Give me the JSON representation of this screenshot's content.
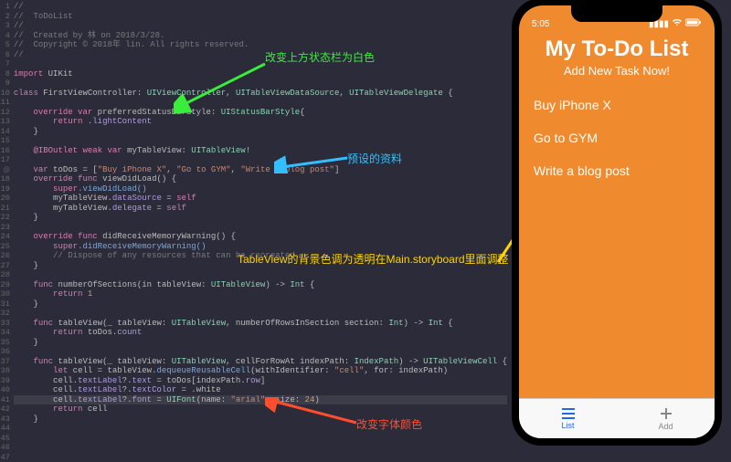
{
  "file": {
    "name": "ToDoList",
    "author": "林 on 2018/3/28."
  },
  "gutter": [
    "1",
    "2",
    "3",
    "4",
    "5",
    "6",
    "7",
    "8",
    "9",
    "10",
    "11",
    "12",
    "13",
    "14",
    "15",
    "16",
    "17",
    "◎",
    "18",
    "19",
    "20",
    "21",
    "22",
    "23",
    "24",
    "25",
    "26",
    "27",
    "28",
    "29",
    "30",
    "31",
    "32",
    "33",
    "34",
    "35",
    "36",
    "37",
    "38",
    "39",
    "40",
    "41",
    "42",
    "43",
    "44",
    "45",
    "46",
    "47"
  ],
  "code": {
    "l1": "//",
    "l2": "//  ToDoList",
    "l3": "//",
    "l4_a": "//  Created by ",
    "l4_b": "林 on 2018/3/28.",
    "l5": "//  Copyright © 2018年 lin. All rights reserved.",
    "l6": "//",
    "l7_kw": "import",
    "l7_b": " UIKit",
    "l9_kw": "class",
    "l9_name": " FirstViewController",
    "l9_b": ": ",
    "l9_t1": "UIViewController",
    "l9_c": ", ",
    "l9_t2": "UITableViewDataSource",
    "l9_d": ", ",
    "l9_t3": "UITableViewDelegate",
    "l9_e": " {",
    "l11_a": "    override var",
    "l11_b": " preferredStatusBarStyle",
    "l11_c": ": ",
    "l11_d": "UIStatusBarStyle",
    "l11_e": "{",
    "l12_a": "        return",
    "l12_b": " .lightContent",
    "l13": "    }",
    "l15_a": "    @IBOutlet weak var",
    "l15_b": " myTableView: ",
    "l15_c": "UITableView",
    "l15_d": "!",
    "l17_a": "    var",
    "l17_b": " toDos = [",
    "l17_s1": "\"Buy iPhone X\"",
    "l17_c": ", ",
    "l17_s2": "\"Go to GYM\"",
    "l17_d": ", ",
    "l17_s3": "\"Write a blog post\"",
    "l17_e": "]",
    "l18_a": "    override func",
    "l18_b": " viewDidLoad() {",
    "l19_a": "        super",
    "l19_b": ".viewDidLoad()",
    "l20_a": "        myTableView.",
    "l20_b": "dataSource",
    "l20_c": " = ",
    "l20_d": "self",
    "l21_a": "        myTableView.",
    "l21_b": "delegate",
    "l21_c": " = ",
    "l21_d": "self",
    "l22": "    }",
    "l24_a": "    override func",
    "l24_b": " didReceiveMemoryWarning() {",
    "l25_a": "        super",
    "l25_b": ".didReceiveMemoryWarning()",
    "l26": "        // Dispose of any resources that can be recreated.",
    "l27": "    }",
    "l29_a": "    func",
    "l29_b": " numberOfSections(in tableView: ",
    "l29_c": "UITableView",
    "l29_d": ") -> ",
    "l29_e": "Int",
    "l29_f": " {",
    "l30_a": "        return",
    "l30_b": " 1",
    "l31": "    }",
    "l33_a": "    func",
    "l33_b": " tableView(_ tableView: ",
    "l33_c": "UITableView",
    "l33_d": ", numberOfRowsInSection section: ",
    "l33_e": "Int",
    "l33_f": ") -> ",
    "l33_g": "Int",
    "l33_h": " {",
    "l34_a": "        return",
    "l34_b": " toDos.",
    "l34_c": "count",
    "l35": "    }",
    "l37_a": "    func",
    "l37_b": " tableView(_ tableView: ",
    "l37_c": "UITableView",
    "l37_d": ", cellForRowAt indexPath: ",
    "l37_e": "IndexPath",
    "l37_f": ") -> ",
    "l37_g": "UITableViewCell",
    "l37_h": " {",
    "l38_a": "        let",
    "l38_b": " cell = tableView.",
    "l38_c": "dequeueReusableCell",
    "l38_d": "(withIdentifier: ",
    "l38_e": "\"cell\"",
    "l38_f": ", for: indexPath)",
    "l39_a": "        cell.",
    "l39_b": "textLabel",
    "l39_c": "?.",
    "l39_d": "text",
    "l39_e": " = toDos[indexPath.",
    "l39_f": "row",
    "l39_g": "]",
    "l40_a": "        cell.",
    "l40_b": "textLabel",
    "l40_c": "?.",
    "l40_d": "textColor",
    "l40_e": " = .white",
    "l41_a": "        cell.",
    "l41_b": "textLabel",
    "l41_c": "?.",
    "l41_d": "font",
    "l41_e": " = ",
    "l41_f": "UIFont",
    "l41_g": "(name: ",
    "l41_h": "\"arial\"",
    "l41_i": ", size: ",
    "l41_j": "24",
    "l41_k": ")",
    "l42_a": "        return",
    "l42_b": " cell",
    "l43": "    }"
  },
  "annotations": {
    "a1": "改变上方状态栏为白色",
    "a2": "预设的资料",
    "a3": "TableView的背景色调为透明在Main.storyboard里面调整",
    "a4": "改变字体颜色"
  },
  "phone": {
    "time": "5:05",
    "title": "My To-Do List",
    "subtitle": "Add New Task Now!",
    "items": [
      "Buy iPhone X",
      "Go to GYM",
      "Write a blog post"
    ],
    "tabs": {
      "list": "List",
      "add": "Add"
    }
  }
}
